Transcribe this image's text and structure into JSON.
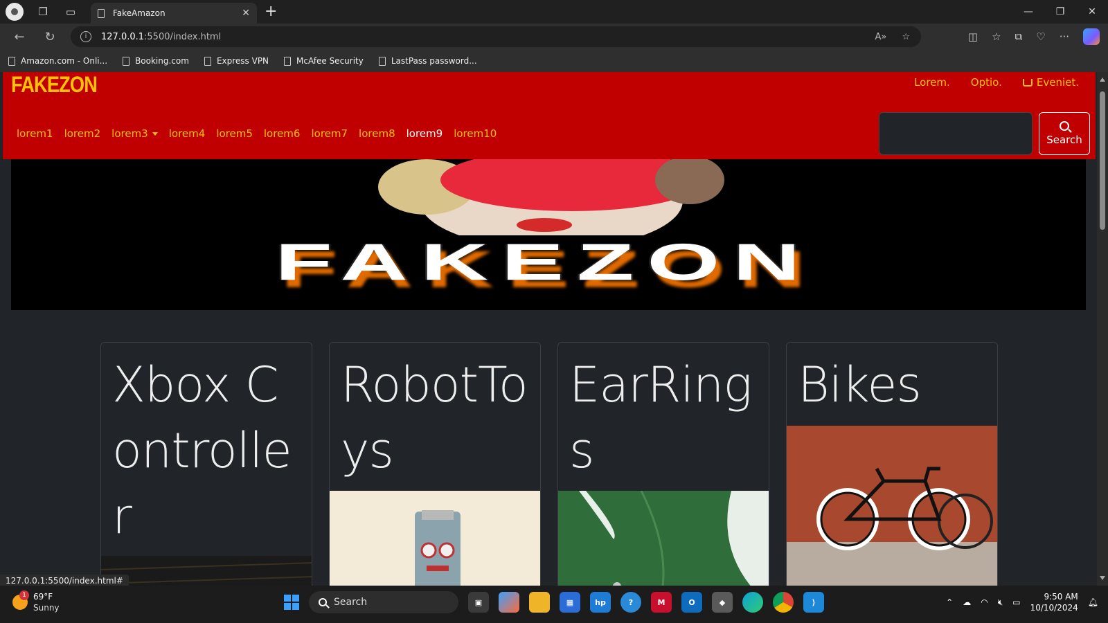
{
  "browser": {
    "tab_title": "FakeAmazon",
    "url_host": "127.0.0.1",
    "url_rest": ":5500/index.html",
    "bookmarks": [
      "Amazon.com - Onli...",
      "Booking.com",
      "Express VPN",
      "McAfee Security",
      "LastPass password..."
    ],
    "status_url": "127.0.0.1:5500/index.html#"
  },
  "site": {
    "brand": "FAKEZON",
    "top_links": [
      "Lorem.",
      "Optio.",
      "Eveniet."
    ],
    "nav": [
      "lorem1",
      "lorem2",
      "lorem3",
      "lorem4",
      "lorem5",
      "lorem6",
      "lorem7",
      "lorem8",
      "lorem9",
      "lorem10"
    ],
    "active_nav": "lorem9",
    "search_value": "",
    "search_label": "Search",
    "banner_text": "FAKEZON",
    "cards": [
      "Xbox Controller",
      "RobotToys",
      "EarRings",
      "Bikes"
    ]
  },
  "colors": {
    "header_bg": "#c00000",
    "accent": "#ffc107",
    "page_bg": "#212529"
  },
  "taskbar": {
    "temperature": "69°F",
    "weather": "Sunny",
    "weather_badge": "1",
    "search_label": "Search",
    "time": "9:50 AM",
    "date": "10/10/2024"
  }
}
